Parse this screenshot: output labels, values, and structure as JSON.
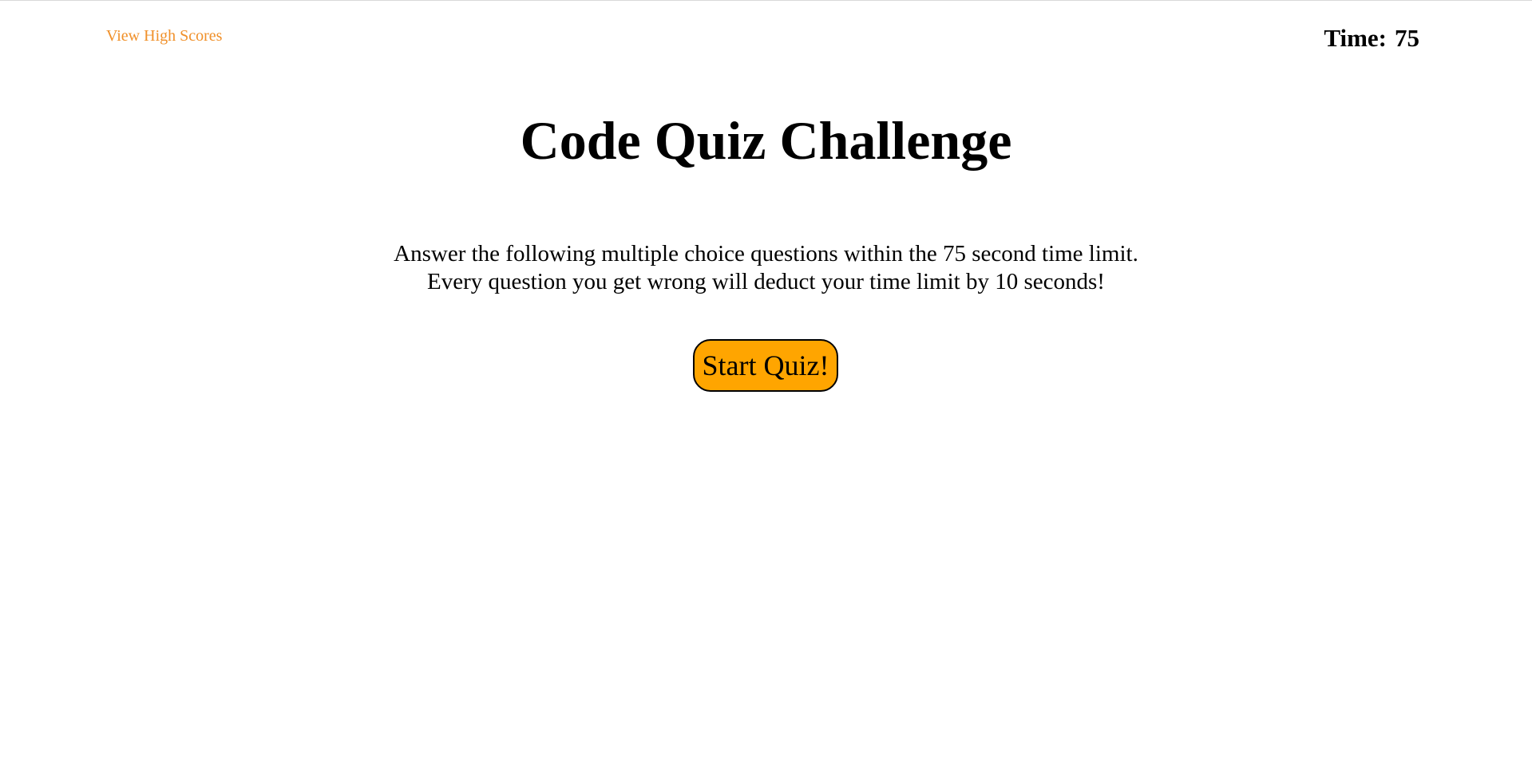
{
  "header": {
    "high_scores_link": "View High Scores",
    "timer_label": "Time:",
    "timer_value": "75"
  },
  "main": {
    "title": "Code Quiz Challenge",
    "instructions": [
      "Answer the following multiple choice questions within the 75 second time limit.",
      "Every question you get wrong will deduct your time limit by 10 seconds!"
    ],
    "start_button_label": "Start Quiz!"
  },
  "colors": {
    "link": "#f0902a",
    "button_background": "#ffa500",
    "button_border": "#000000",
    "text": "#000000",
    "background": "#ffffff"
  }
}
